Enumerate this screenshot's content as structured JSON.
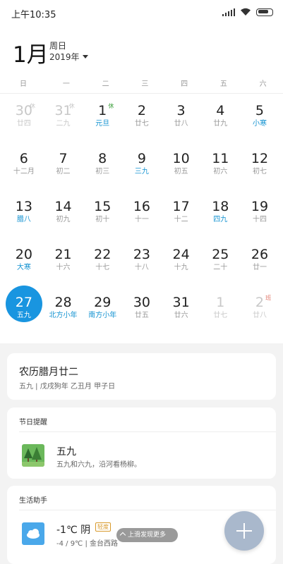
{
  "status_bar": {
    "time": "上午10:35"
  },
  "header": {
    "month": "1月",
    "weekday_label": "周日",
    "year": "2019年"
  },
  "weekdays": [
    "日",
    "一",
    "二",
    "三",
    "四",
    "五",
    "六"
  ],
  "calendar": {
    "weeks": [
      [
        {
          "day": "30",
          "lunar": "廿四",
          "mark": "休",
          "state": "dim"
        },
        {
          "day": "31",
          "lunar": "二九",
          "mark": "休",
          "state": "dim"
        },
        {
          "day": "1",
          "lunar": "元旦",
          "mark": "休",
          "state": "festival"
        },
        {
          "day": "2",
          "lunar": "廿七"
        },
        {
          "day": "3",
          "lunar": "廿八"
        },
        {
          "day": "4",
          "lunar": "廿九"
        },
        {
          "day": "5",
          "lunar": "小寒",
          "state": "festival"
        }
      ],
      [
        {
          "day": "6",
          "lunar": "十二月"
        },
        {
          "day": "7",
          "lunar": "初二"
        },
        {
          "day": "8",
          "lunar": "初三"
        },
        {
          "day": "9",
          "lunar": "三九",
          "state": "festival"
        },
        {
          "day": "10",
          "lunar": "初五"
        },
        {
          "day": "11",
          "lunar": "初六"
        },
        {
          "day": "12",
          "lunar": "初七"
        }
      ],
      [
        {
          "day": "13",
          "lunar": "腊八",
          "state": "festival"
        },
        {
          "day": "14",
          "lunar": "初九"
        },
        {
          "day": "15",
          "lunar": "初十"
        },
        {
          "day": "16",
          "lunar": "十一"
        },
        {
          "day": "17",
          "lunar": "十二"
        },
        {
          "day": "18",
          "lunar": "四九",
          "state": "festival"
        },
        {
          "day": "19",
          "lunar": "十四"
        }
      ],
      [
        {
          "day": "20",
          "lunar": "大寒",
          "state": "festival"
        },
        {
          "day": "21",
          "lunar": "十六"
        },
        {
          "day": "22",
          "lunar": "十七"
        },
        {
          "day": "23",
          "lunar": "十八"
        },
        {
          "day": "24",
          "lunar": "十九"
        },
        {
          "day": "25",
          "lunar": "二十"
        },
        {
          "day": "26",
          "lunar": "廿一"
        }
      ],
      [
        {
          "day": "27",
          "lunar": "五九",
          "state": "today"
        },
        {
          "day": "28",
          "lunar": "北方小年",
          "state": "festival"
        },
        {
          "day": "29",
          "lunar": "南方小年",
          "state": "festival"
        },
        {
          "day": "30",
          "lunar": "廿五"
        },
        {
          "day": "31",
          "lunar": "廿六"
        },
        {
          "day": "1",
          "lunar": "廿七",
          "state": "dim"
        },
        {
          "day": "2",
          "lunar": "廿八",
          "mark": "班",
          "state": "dim"
        }
      ]
    ]
  },
  "lunar_card": {
    "title": "农历腊月廿二",
    "subtitle": "五九 | 戊戌狗年 乙丑月 甲子日"
  },
  "festival_card": {
    "header": "节日提醒",
    "title": "五九",
    "description": "五九和六九，沿河看杨柳。"
  },
  "life_card": {
    "header": "生活助手",
    "temperature": "-1℃ 阴",
    "aqi": "轻度",
    "range": "-4 / 9℃ | 金台西路"
  },
  "discover_label": "上滑发现更多",
  "colors": {
    "accent": "#1995e0",
    "festival_text": "#1493d1",
    "fab": "#a9b8cc"
  }
}
